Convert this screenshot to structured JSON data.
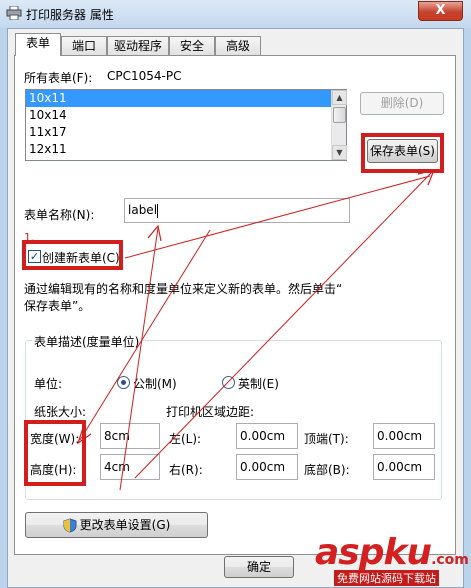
{
  "window": {
    "title": "打印服务器 属性",
    "close_glyph": "X"
  },
  "tabs": [
    {
      "label": "表单",
      "active": true
    },
    {
      "label": "端口",
      "active": false
    },
    {
      "label": "驱动程序",
      "active": false
    },
    {
      "label": "安全",
      "active": false
    },
    {
      "label": "高级",
      "active": false
    }
  ],
  "forms_panel": {
    "all_forms_label": "所有表单(F):",
    "computer_name": "CPC1054-PC",
    "forms_list": [
      "10x11",
      "10x14",
      "11x17",
      "12x11"
    ],
    "selected_form": "10x11",
    "delete_button": "删除(D)",
    "save_button": "保存表单(S)",
    "form_name_label": "表单名称(N):",
    "form_name_value": "label",
    "annotation_number": "1.",
    "create_new_checkbox": "创建新表单(C)",
    "create_new_checked": true,
    "hint_text_line1": "通过编辑现有的名称和度量单位来定义新的表单。然后单击“",
    "hint_text_line2": "保存表单”。",
    "check_glyph": "✓"
  },
  "description_group": {
    "title": "表单描述(度量单位)",
    "unit_label": "单位:",
    "unit_options": [
      {
        "label": "公制(M)",
        "selected": true
      },
      {
        "label": "英制(E)",
        "selected": false
      }
    ],
    "paper_size_label": "纸张大小:",
    "margins_label": "打印机区域边距:",
    "width_label": "宽度(W):",
    "width_value": "8cm",
    "height_label": "高度(H):",
    "height_value": "4cm",
    "left_label": "左(L):",
    "left_value": "0.00cm",
    "right_label": "右(R):",
    "right_value": "0.00cm",
    "top_label": "顶端(T):",
    "top_value": "0.00cm",
    "bottom_label": "底部(B):",
    "bottom_value": "0.00cm"
  },
  "change_settings_button": "更改表单设置(G)",
  "ok_button": "确定",
  "watermark": {
    "text": "aspku",
    "suffix": ".com",
    "sub": "免费网站源码下载站"
  },
  "colors": {
    "annotation_red": "#d11f1f",
    "selection_blue": "#3399ff"
  },
  "icons": [
    "printer-icon",
    "shield-icon",
    "check-icon"
  ]
}
